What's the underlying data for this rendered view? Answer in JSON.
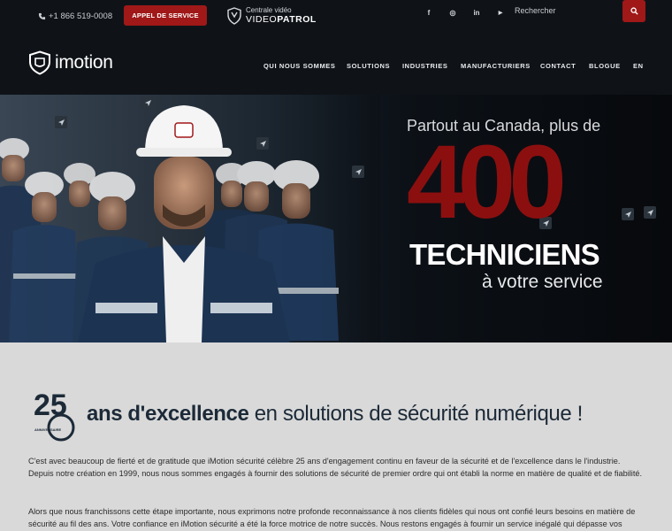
{
  "topbar": {
    "phone": "+1 866 519-0008",
    "cta_label": "APPEL DE SERVICE",
    "videopatrol_small": "Centrale vidéo",
    "videopatrol_big_light": "VIDEO",
    "videopatrol_big_bold": "PATROL",
    "social": [
      {
        "icon": "facebook-icon",
        "glyph": "f"
      },
      {
        "icon": "instagram-icon",
        "glyph": "◎"
      },
      {
        "icon": "linkedin-icon",
        "glyph": "in"
      },
      {
        "icon": "youtube-icon",
        "glyph": "▶"
      }
    ],
    "search_placeholder": "Rechercher"
  },
  "header": {
    "logo_text": "imotion",
    "nav": [
      "QUI NOUS SOMMES",
      "SOLUTIONS",
      "INDUSTRIES",
      "MANUFACTURIERS",
      "CONTACT",
      "BLOGUE",
      "EN"
    ]
  },
  "hero": {
    "subtitle": "Partout au Canada, plus de",
    "number": "400",
    "techniciens": "TECHNICIENS",
    "service": "à votre service"
  },
  "about": {
    "badge_number": "25",
    "badge_caption": "ANNIVERSAIRE",
    "headline_bold": "ans d'excellence",
    "headline_rest": " en solutions de sécurité numérique !",
    "paragraph1": "C'est avec beaucoup de fierté et de gratitude que iMotion sécurité célèbre 25 ans d'engagement continu en faveur de la sécurité et de l'excellence dans le l'industrie. Depuis notre création en 1999, nous nous sommes engagés à fournir des solutions de sécurité de premier ordre qui ont établi la norme en matière de qualité et de fiabilité.",
    "paragraph2": "Alors que nous franchissons cette étape importante, nous exprimons notre profonde reconnaissance à nos clients fidèles qui nous ont confié leurs besoins en matière de sécurité au fil des ans. Votre confiance en iMotion sécurité a été la force motrice de notre succès. Nous restons engagés à fournir un service inégalé qui dépasse vos"
  },
  "colors": {
    "brand_red": "#a01818",
    "dark_bg": "#0f1318",
    "hero_number": "#8c0f0f",
    "section_bg": "#d9d9d9"
  }
}
